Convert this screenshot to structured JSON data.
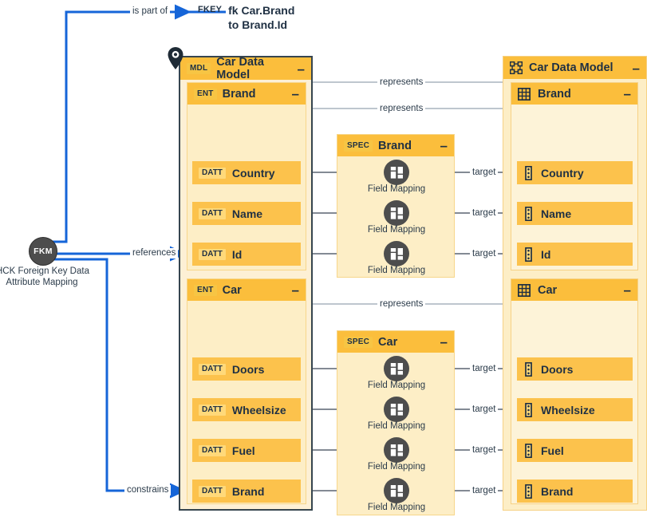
{
  "diagram": {
    "title_node": {
      "tag": "FKEY",
      "line1": "fk Car.Brand",
      "line2": "to Brand.Id"
    },
    "fkm_node": {
      "badge": "FKM",
      "caption_line1": "HCK Foreign Key Data",
      "caption_line2": "Attribute Mapping"
    },
    "edge_labels": {
      "is_part_of": "is part of",
      "references": "references",
      "constrains": "constrains",
      "represents": "represents",
      "target": "target"
    },
    "model_container": {
      "tag": "MDL",
      "title": "Car Data Model",
      "collapse": "–",
      "pin_icon": "location-pin-icon"
    },
    "entities": [
      {
        "tag": "ENT",
        "title": "Brand",
        "collapse": "–",
        "attributes": [
          {
            "tag": "DATT",
            "name": "Country"
          },
          {
            "tag": "DATT",
            "name": "Name"
          },
          {
            "tag": "DATT",
            "name": "Id"
          }
        ]
      },
      {
        "tag": "ENT",
        "title": "Car",
        "collapse": "–",
        "attributes": [
          {
            "tag": "DATT",
            "name": "Doors"
          },
          {
            "tag": "DATT",
            "name": "Wheelsize"
          },
          {
            "tag": "DATT",
            "name": "Fuel"
          },
          {
            "tag": "DATT",
            "name": "Brand"
          }
        ]
      }
    ],
    "specs": [
      {
        "tag": "SPEC",
        "title": "Brand",
        "collapse": "–",
        "mappings": [
          {
            "label": "Field Mapping"
          },
          {
            "label": "Field Mapping"
          },
          {
            "label": "Field Mapping"
          }
        ]
      },
      {
        "tag": "SPEC",
        "title": "Car",
        "collapse": "–",
        "mappings": [
          {
            "label": "Field Mapping"
          },
          {
            "label": "Field Mapping"
          },
          {
            "label": "Field Mapping"
          },
          {
            "label": "Field Mapping"
          }
        ]
      }
    ],
    "target_model": {
      "title": "Car Data Model",
      "collapse": "–",
      "icon": "network-nodes-icon",
      "tables": [
        {
          "title": "Brand",
          "collapse": "–",
          "icon": "table-grid-icon",
          "columns": [
            {
              "name": "Country",
              "icon": "column-icon"
            },
            {
              "name": "Name",
              "icon": "column-icon"
            },
            {
              "name": "Id",
              "icon": "column-icon"
            }
          ]
        },
        {
          "title": "Car",
          "collapse": "–",
          "icon": "table-grid-icon",
          "columns": [
            {
              "name": "Doors",
              "icon": "column-icon"
            },
            {
              "name": "Wheelsize",
              "icon": "column-icon"
            },
            {
              "name": "Fuel",
              "icon": "column-icon"
            },
            {
              "name": "Brand",
              "icon": "column-icon"
            }
          ]
        }
      ]
    },
    "colors": {
      "accent_blue": "#1565d8",
      "header_orange": "#fbbe3c",
      "attr_orange": "#fcc24c",
      "panel_cream": "#fdeec6",
      "dark_node": "#4d4d4d",
      "outline_dark": "#36454f",
      "gray_edge": "#a9b4bd",
      "dark_edge": "#5a6470"
    }
  }
}
